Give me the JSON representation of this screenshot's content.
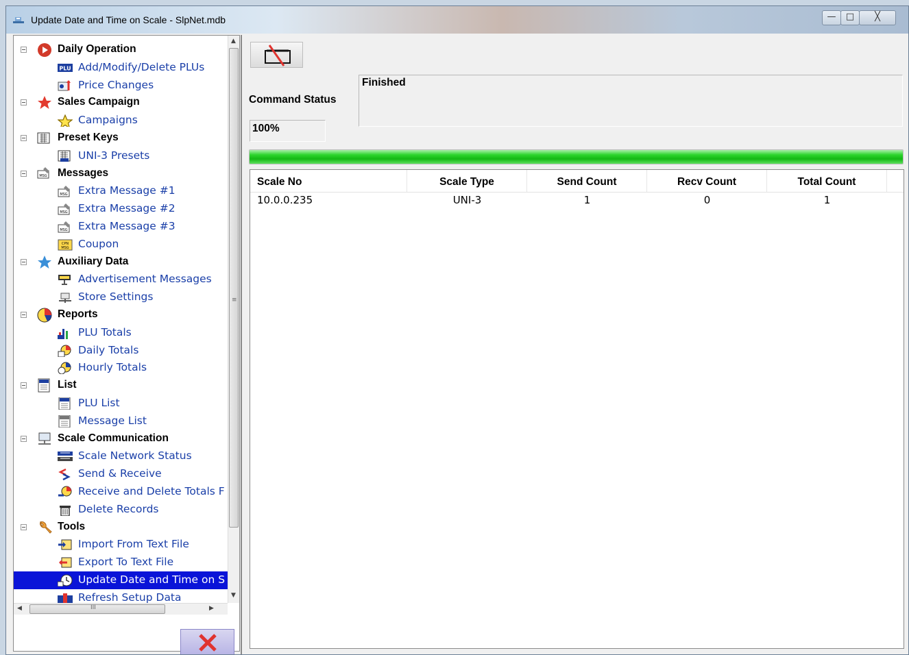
{
  "window": {
    "title": "Update Date and Time on Scale - SlpNet.mdb",
    "controls": {
      "minimize": "—",
      "maximize": "□",
      "close": "╳"
    }
  },
  "tree": [
    {
      "label": "Daily Operation",
      "icon": "play-icon",
      "children": [
        {
          "label": "Add/Modify/Delete PLUs",
          "icon": "plu-icon"
        },
        {
          "label": "Price Changes",
          "icon": "price-change-icon"
        }
      ]
    },
    {
      "label": "Sales Campaign",
      "icon": "star-red-icon",
      "children": [
        {
          "label": "Campaigns",
          "icon": "star-outline-icon"
        }
      ]
    },
    {
      "label": "Preset Keys",
      "icon": "preset-keys-icon",
      "children": [
        {
          "label": "UNI-3 Presets",
          "icon": "presets-icon"
        }
      ]
    },
    {
      "label": "Messages",
      "icon": "message-icon",
      "children": [
        {
          "label": "Extra Message #1",
          "icon": "message-icon"
        },
        {
          "label": "Extra Message #2",
          "icon": "message-icon"
        },
        {
          "label": "Extra Message #3",
          "icon": "message-icon"
        },
        {
          "label": "Coupon",
          "icon": "coupon-icon"
        }
      ]
    },
    {
      "label": "Auxiliary Data",
      "icon": "star-blue-icon",
      "children": [
        {
          "label": "Advertisement Messages",
          "icon": "advertisement-icon"
        },
        {
          "label": "Store Settings",
          "icon": "store-settings-icon"
        }
      ]
    },
    {
      "label": "Reports",
      "icon": "pie-chart-icon",
      "children": [
        {
          "label": "PLU Totals",
          "icon": "bar-chart-icon"
        },
        {
          "label": "Daily Totals",
          "icon": "daily-totals-icon"
        },
        {
          "label": "Hourly Totals",
          "icon": "hourly-totals-icon"
        }
      ]
    },
    {
      "label": "List",
      "icon": "list-icon",
      "children": [
        {
          "label": "PLU List",
          "icon": "plu-list-icon"
        },
        {
          "label": "Message List",
          "icon": "message-list-icon"
        }
      ]
    },
    {
      "label": "Scale Communication",
      "icon": "network-icon",
      "children": [
        {
          "label": "Scale Network Status",
          "icon": "network-status-icon"
        },
        {
          "label": "Send & Receive",
          "icon": "send-receive-icon"
        },
        {
          "label": "Receive and Delete Totals F",
          "icon": "receive-delete-icon"
        },
        {
          "label": "Delete Records",
          "icon": "trash-icon"
        }
      ]
    },
    {
      "label": "Tools",
      "icon": "tools-icon",
      "children": [
        {
          "label": "Import From Text File",
          "icon": "import-icon"
        },
        {
          "label": "Export To Text File",
          "icon": "export-icon"
        },
        {
          "label": "Update Date and Time on S",
          "icon": "clock-icon",
          "selected": true
        },
        {
          "label": "Refresh Setup Data",
          "icon": "refresh-icon"
        }
      ]
    }
  ],
  "scroll": {
    "h_thumb_label": "III"
  },
  "command": {
    "label": "Command Status",
    "status_text": "Finished",
    "percent_text": "100%",
    "progress": 1.0
  },
  "grid": {
    "columns": [
      "Scale No",
      "Scale Type",
      "Send Count",
      "Recv Count",
      "Total Count"
    ],
    "rows": [
      [
        "10.0.0.235",
        "UNI-3",
        "1",
        "0",
        "1"
      ]
    ]
  },
  "colors": {
    "selection": "#0a14d8",
    "link": "#1a3fa8",
    "progress": "#14b814"
  }
}
